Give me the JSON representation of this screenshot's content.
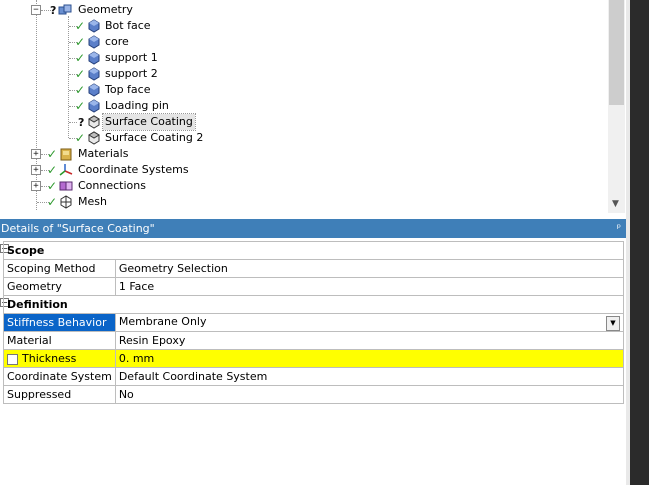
{
  "tree": {
    "nodes": [
      {
        "label": "Geometry",
        "status": "question",
        "icon": "geometry-icon"
      },
      {
        "label": "Bot face",
        "status": "check",
        "icon": "body-cube-icon"
      },
      {
        "label": "core",
        "status": "check",
        "icon": "body-cube-icon"
      },
      {
        "label": "support 1",
        "status": "check",
        "icon": "body-cube-icon"
      },
      {
        "label": "support 2",
        "status": "check",
        "icon": "body-cube-icon"
      },
      {
        "label": "Top face",
        "status": "check",
        "icon": "body-cube-icon"
      },
      {
        "label": "Loading pin",
        "status": "check",
        "icon": "body-cube-icon"
      },
      {
        "label": "Surface Coating",
        "status": "question",
        "icon": "surface-body-icon"
      },
      {
        "label": "Surface Coating 2",
        "status": "check",
        "icon": "surface-body-icon"
      },
      {
        "label": "Materials",
        "status": "check",
        "icon": "materials-icon"
      },
      {
        "label": "Coordinate Systems",
        "status": "check",
        "icon": "coordinate-systems-icon"
      },
      {
        "label": "Connections",
        "status": "check",
        "icon": "connections-icon"
      },
      {
        "label": "Mesh",
        "status": "check",
        "icon": "mesh-icon"
      }
    ],
    "expander_collapse": "−",
    "expander_expand": "+",
    "check_glyph": "✓",
    "question_glyph": "?",
    "scroll_down_glyph": "▼"
  },
  "details": {
    "title": "Details of \"Surface Coating\"",
    "pin_glyph": "ᵖ",
    "scope": {
      "section_label": "Scope",
      "rows": [
        {
          "property": "Scoping Method",
          "value": "Geometry Selection"
        },
        {
          "property": "Geometry",
          "value": "1 Face"
        }
      ]
    },
    "definition": {
      "section_label": "Definition",
      "stiffness": {
        "property": "Stiffness Behavior",
        "value": "Membrane Only"
      },
      "material": {
        "property": "Material",
        "value": "Resin Epoxy"
      },
      "thickness": {
        "property": "Thickness",
        "value": "0. mm"
      },
      "coordinate_system": {
        "property": "Coordinate System",
        "value": "Default Coordinate System"
      },
      "suppressed": {
        "property": "Suppressed",
        "value": "No"
      }
    },
    "dropdown_glyph": "▼",
    "collapse_glyph": "−"
  },
  "colors": {
    "header_blue": "#3f7fb8",
    "selection_blue": "#0a64c8",
    "highlight_yellow": "#ffff00",
    "check_green": "#2f9a2f"
  }
}
